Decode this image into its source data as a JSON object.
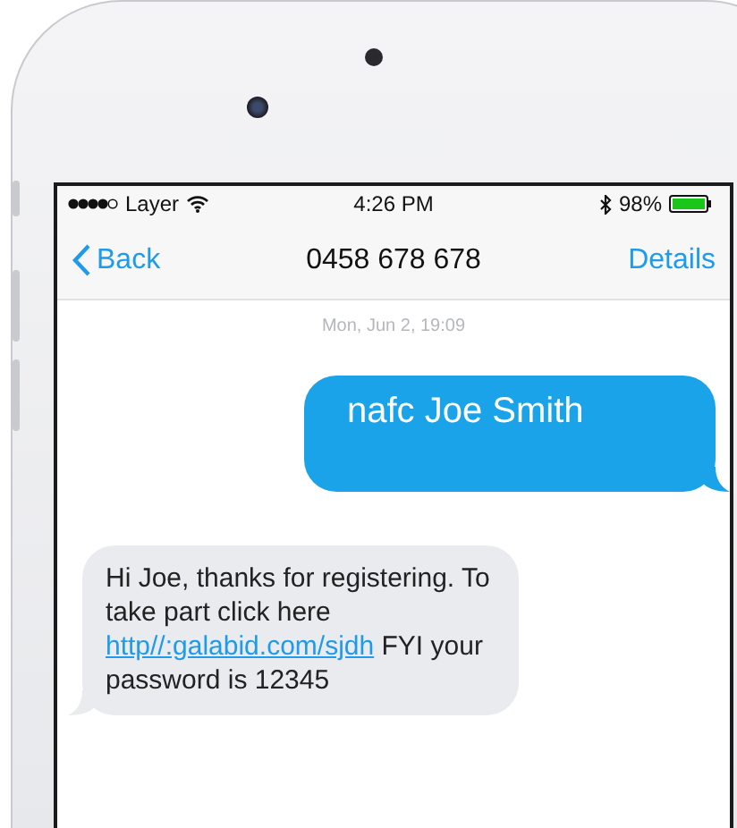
{
  "status_bar": {
    "carrier": "Layer",
    "time": "4:26 PM",
    "battery": "98%"
  },
  "nav_bar": {
    "back": "Back",
    "title": "0458 678 678",
    "action": "Details"
  },
  "timestamp": "Mon, Jun 2, 19:09",
  "messages": [
    {
      "kind": "sent",
      "text": "nafc Joe Smith"
    },
    {
      "kind": "received",
      "text_before": "Hi Joe, thanks for registering. To take part click here",
      "link": "http//:galabid.com/sjdh",
      "text_after": "FYI your password is 12345"
    }
  ]
}
